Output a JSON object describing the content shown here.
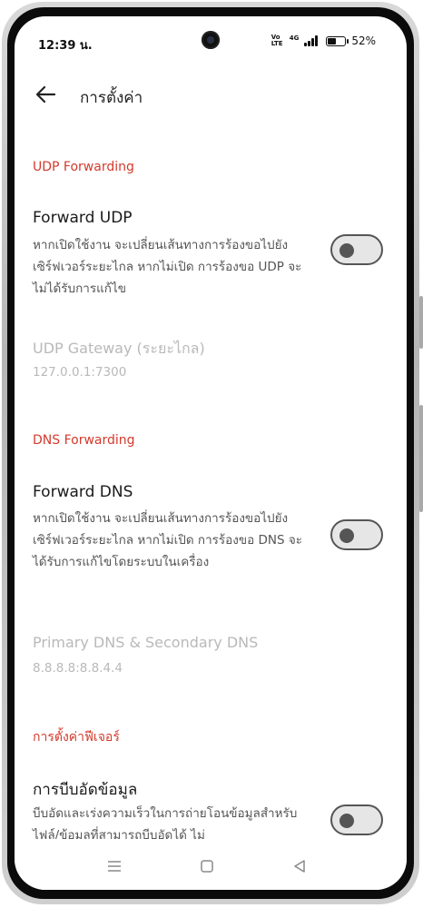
{
  "status_bar": {
    "time": "12:39 น.",
    "network_badge": "Vo LTE",
    "network_type": "4G",
    "battery_percent": "52%",
    "battery_level": 0.52
  },
  "header": {
    "back_icon": "back-arrow-icon",
    "title": "การตั้งค่า"
  },
  "sections": {
    "udp": {
      "heading": "UDP Forwarding",
      "forward_udp": {
        "title": "Forward UDP",
        "description": "หากเปิดใช้งาน จะเปลี่ยนเส้นทางการร้องขอไปยังเซิร์ฟเวอร์ระยะไกล หากไม่เปิด การร้องขอ UDP จะไม่ได้รับการแก้ไข",
        "enabled": false
      },
      "gateway": {
        "title": "UDP Gateway (ระยะไกล)",
        "value": "127.0.0.1:7300"
      }
    },
    "dns": {
      "heading": "DNS Forwarding",
      "forward_dns": {
        "title": "Forward DNS",
        "description": "หากเปิดใช้งาน จะเปลี่ยนเส้นทางการร้องขอไปยังเซิร์ฟเวอร์ระยะไกล หากไม่เปิด การร้องขอ DNS จะได้รับการแก้ไขโดยระบบในเครื่อง",
        "enabled": false
      },
      "servers": {
        "title": "Primary DNS & Secondary DNS",
        "value": "8.8.8.8:8.8.4.4"
      }
    },
    "features": {
      "heading": "การตั้งค่าฟีเจอร์",
      "compression": {
        "title": "การบีบอัดข้อมูล",
        "description": "บีบอัดและเร่งความเร็วในการถ่ายโอนข้อมูลสำหรับไฟล์/ข้อมูลที่สามารถบีบอัดได้ ไม่",
        "enabled": false
      }
    }
  },
  "nav_bar": {
    "menu_icon": "recent-apps-icon",
    "home_icon": "home-icon",
    "back_icon": "back-triangle-icon"
  }
}
